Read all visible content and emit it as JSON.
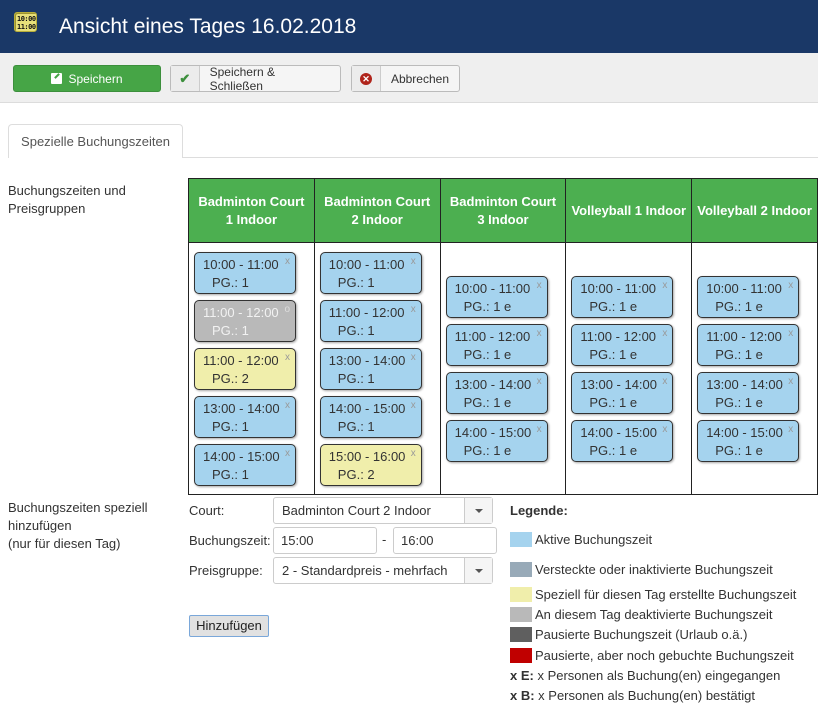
{
  "header": {
    "icon_text_line1": "10:00",
    "icon_text_line2": "11:00",
    "title": "Ansicht eines Tages 16.02.2018"
  },
  "toolbar": {
    "save_label": "Speichern",
    "save_close_label": "Speichern & Schließen",
    "cancel_label": "Abbrechen"
  },
  "tabs": [
    {
      "label": "Spezielle Buchungszeiten",
      "active": true
    }
  ],
  "sections": {
    "times_label_line1": "Buchungszeiten und",
    "times_label_line2": "Preisgruppen",
    "add_label_line1": "Buchungszeiten speziell",
    "add_label_line2": "hinzufügen",
    "add_label_line3": "(nur für diesen Tag)"
  },
  "schedule": {
    "columns": [
      {
        "name": "Badminton Court 1 Indoor",
        "slots": [
          {
            "time": "10:00 - 11:00",
            "pg": "PG.: 1",
            "status": "active",
            "mark": "x"
          },
          {
            "time": "11:00 - 12:00",
            "pg": "PG.: 1",
            "status": "deactivated",
            "mark": "o"
          },
          {
            "time": "11:00 - 12:00",
            "pg": "PG.: 2",
            "status": "special",
            "mark": "x"
          },
          {
            "time": "13:00 - 14:00",
            "pg": "PG.: 1",
            "status": "active",
            "mark": "x"
          },
          {
            "time": "14:00 - 15:00",
            "pg": "PG.: 1",
            "status": "active",
            "mark": "x"
          }
        ]
      },
      {
        "name": "Badminton Court 2 Indoor",
        "slots": [
          {
            "time": "10:00 - 11:00",
            "pg": "PG.: 1",
            "status": "active",
            "mark": "x"
          },
          {
            "time": "11:00 - 12:00",
            "pg": "PG.: 1",
            "status": "active",
            "mark": "x"
          },
          {
            "time": "13:00 - 14:00",
            "pg": "PG.: 1",
            "status": "active",
            "mark": "x"
          },
          {
            "time": "14:00 - 15:00",
            "pg": "PG.: 1",
            "status": "active",
            "mark": "x"
          },
          {
            "time": "15:00 - 16:00",
            "pg": "PG.: 2",
            "status": "special",
            "mark": "x"
          }
        ]
      },
      {
        "name": "Badminton Court 3 Indoor",
        "slots": [
          {
            "time": "10:00 - 11:00",
            "pg": "PG.: 1 e",
            "status": "active",
            "mark": "x"
          },
          {
            "time": "11:00 - 12:00",
            "pg": "PG.: 1 e",
            "status": "active",
            "mark": "x"
          },
          {
            "time": "13:00 - 14:00",
            "pg": "PG.: 1 e",
            "status": "active",
            "mark": "x"
          },
          {
            "time": "14:00 - 15:00",
            "pg": "PG.: 1 e",
            "status": "active",
            "mark": "x"
          }
        ]
      },
      {
        "name": "Volleyball 1 Indoor",
        "slots": [
          {
            "time": "10:00 - 11:00",
            "pg": "PG.: 1 e",
            "status": "active",
            "mark": "x"
          },
          {
            "time": "11:00 - 12:00",
            "pg": "PG.: 1 e",
            "status": "active",
            "mark": "x"
          },
          {
            "time": "13:00 - 14:00",
            "pg": "PG.: 1 e",
            "status": "active",
            "mark": "x"
          },
          {
            "time": "14:00 - 15:00",
            "pg": "PG.: 1 e",
            "status": "active",
            "mark": "x"
          }
        ]
      },
      {
        "name": "Volleyball 2 Indoor",
        "slots": [
          {
            "time": "10:00 - 11:00",
            "pg": "PG.: 1 e",
            "status": "active",
            "mark": "x"
          },
          {
            "time": "11:00 - 12:00",
            "pg": "PG.: 1 e",
            "status": "active",
            "mark": "x"
          },
          {
            "time": "13:00 - 14:00",
            "pg": "PG.: 1 e",
            "status": "active",
            "mark": "x"
          },
          {
            "time": "14:00 - 15:00",
            "pg": "PG.: 1 e",
            "status": "active",
            "mark": "x"
          }
        ]
      }
    ]
  },
  "form": {
    "court_label": "Court:",
    "court_value": "Badminton Court 2 Indoor",
    "time_label": "Buchungszeit:",
    "time_from": "15:00",
    "time_separator": "-",
    "time_to": "16:00",
    "pricegroup_label": "Preisgruppe:",
    "pricegroup_value": "2 - Standardpreis - mehrfach",
    "add_button": "Hinzufügen"
  },
  "legend": {
    "title": "Legende:",
    "items": [
      {
        "label": "Aktive Buchungszeit",
        "color": "#a5d3ee"
      },
      {
        "label": "Versteckte oder inaktivierte Buchungszeit",
        "color": "#98aab8"
      },
      {
        "label": "Speziell für diesen Tag erstellte Buchungszeit",
        "color": "#f0eeab"
      },
      {
        "label": "An diesem Tag deaktivierte Buchungszeit",
        "color": "#b9b9b9"
      },
      {
        "label": "Pausierte Buchungszeit (Urlaub o.ä.)",
        "color": "#5f5f5f"
      },
      {
        "label": "Pausierte, aber noch gebuchte Buchungszeit",
        "color": "#c00000"
      }
    ],
    "notes": [
      {
        "key": "x E:",
        "text": " x Personen als Buchung(en) eingegangen"
      },
      {
        "key": "x B:",
        "text": " x Personen als Buchung(en) bestätigt"
      }
    ]
  },
  "colors": {
    "header_bg": "#1a3867",
    "save_green": "#46a546",
    "column_header_green": "#4caf50"
  }
}
